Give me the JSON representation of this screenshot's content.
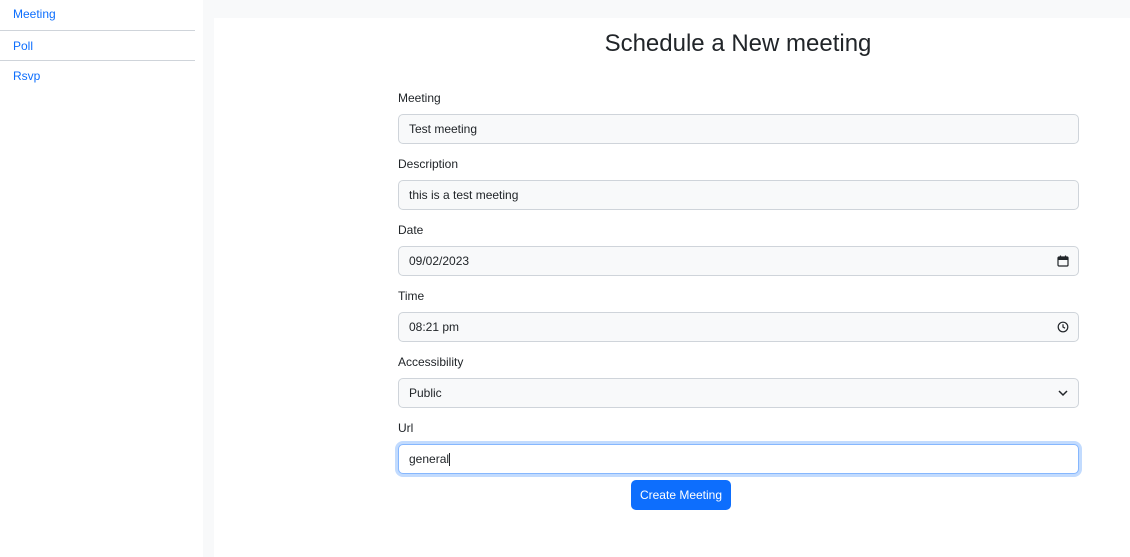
{
  "sidebar": {
    "items": [
      {
        "label": "Meeting"
      },
      {
        "label": "Poll"
      },
      {
        "label": "Rsvp"
      }
    ]
  },
  "form": {
    "title": "Schedule a New meeting",
    "meeting": {
      "label": "Meeting",
      "value": "Test meeting"
    },
    "description": {
      "label": "Description",
      "value": "this is a test meeting"
    },
    "date": {
      "label": "Date",
      "value": "09/02/2023",
      "icon": "calendar-icon"
    },
    "time": {
      "label": "Time",
      "value": "08:21 pm",
      "icon": "clock-icon"
    },
    "accessibility": {
      "label": "Accessibility",
      "value": "Public",
      "icon": "chevron-down-icon"
    },
    "url": {
      "label": "Url",
      "value": "general"
    },
    "submit_label": "Create Meeting"
  },
  "colors": {
    "accent": "#0d6efd",
    "focus_border": "#86b7fe",
    "field_bg": "#f8f9fa",
    "field_border": "#cfd4da"
  }
}
